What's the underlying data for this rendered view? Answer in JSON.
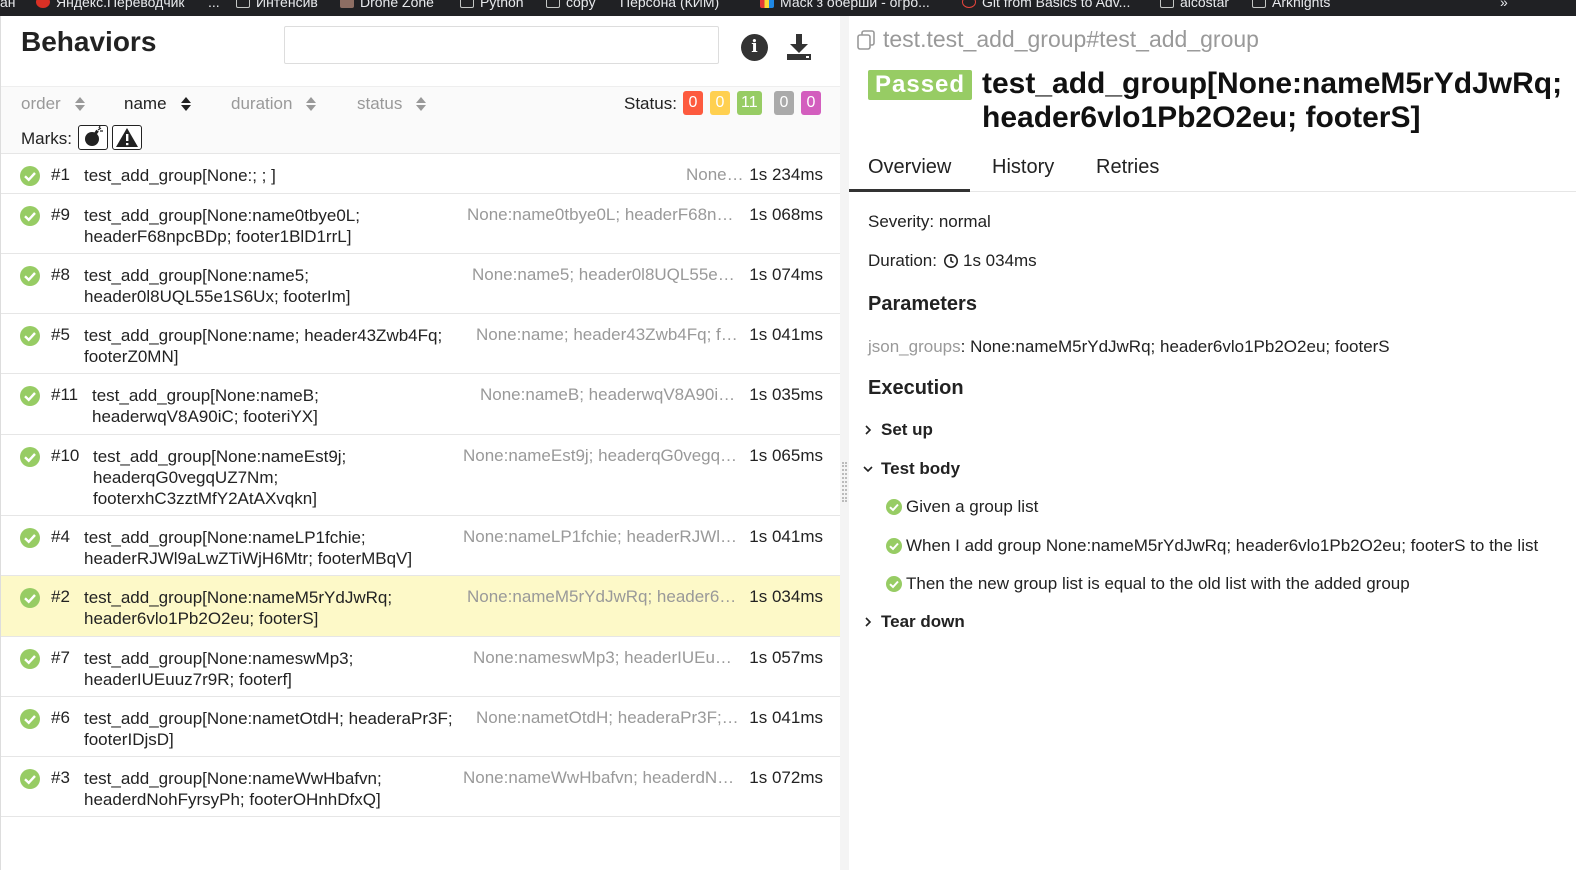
{
  "browser": {
    "bookmarks": [
      {
        "label": "ан",
        "icon": "none"
      },
      {
        "label": "Яндекс.Переводчик",
        "icon": "red"
      },
      {
        "label": "...",
        "icon": "none"
      },
      {
        "label": "Интенсив",
        "icon": "folder"
      },
      {
        "label": "Drone Zone",
        "icon": "dz"
      },
      {
        "label": "Python",
        "icon": "folder"
      },
      {
        "label": "copy",
        "icon": "folder"
      },
      {
        "label": "Персона (КИМ)",
        "icon": "none"
      },
      {
        "label": "Маск з оберши - огро...",
        "icon": "flag"
      },
      {
        "label": "Git from Basics to Adv...",
        "icon": "git"
      },
      {
        "label": "alcostar",
        "icon": "folder"
      },
      {
        "label": "Arknights",
        "icon": "folder"
      },
      {
        "label": "»",
        "icon": "none"
      }
    ]
  },
  "left": {
    "title": "Behaviors",
    "search": {
      "value": "",
      "placeholder": ""
    },
    "sort": {
      "order": "order",
      "name": "name",
      "duration": "duration",
      "status": "status"
    },
    "status_label": "Status:",
    "status_counts": [
      {
        "value": "0",
        "color": "#fd5a3e"
      },
      {
        "value": "0",
        "color": "#ffd050"
      },
      {
        "value": "11",
        "color": "#97cc64"
      },
      {
        "value": "0",
        "color": "#aaaaaa"
      },
      {
        "value": "0",
        "color": "#d35ebe"
      }
    ],
    "marks_label": "Marks:",
    "marks": [
      {
        "icon": "bomb-icon"
      },
      {
        "icon": "warning-icon"
      }
    ],
    "rows": [
      {
        "num": "#1",
        "name": "test_add_group[None:; ; ]",
        "params": "None:; ;",
        "duration": "1s 234ms",
        "selected": false
      },
      {
        "num": "#9",
        "name": "test_add_group[None:name0tbye0L; headerF68npcBDp; footer1BlD1rrL]",
        "params": "None:name0tbye0L; headerF68n…",
        "duration": "1s 068ms",
        "selected": false
      },
      {
        "num": "#8",
        "name": "test_add_group[None:name5; header0l8UQL55e1S6Ux; footerIm]",
        "params": "None:name5; header0l8UQL55e…",
        "duration": "1s 074ms",
        "selected": false
      },
      {
        "num": "#5",
        "name": "test_add_group[None:name; header43Zwb4Fq; footerZ0MN]",
        "params": "None:name; header43Zwb4Fq; f…",
        "duration": "1s 041ms",
        "selected": false
      },
      {
        "num": "#11",
        "name": "test_add_group[None:nameB; headerwqV8A90iC; footeriYX]",
        "params": "None:nameB; headerwqV8A90i…",
        "duration": "1s 035ms",
        "selected": false
      },
      {
        "num": "#10",
        "name": "test_add_group[None:nameEst9j; headerqG0vegqUZ7Nm; footerxhC3zztMfY2AtAXvqkn]",
        "params": "None:nameEst9j; headerqG0vegq…",
        "duration": "1s 065ms",
        "selected": false
      },
      {
        "num": "#4",
        "name": "test_add_group[None:nameLP1fchie; headerRJWl9aLwZTiWjH6Mtr; footerMBqV]",
        "params": "None:nameLP1fchie; headerRJWl…",
        "duration": "1s 041ms",
        "selected": false
      },
      {
        "num": "#2",
        "name": "test_add_group[None:nameM5rYdJwRq; header6vlo1Pb2O2eu; footerS]",
        "params": "None:nameM5rYdJwRq; header6…",
        "duration": "1s 034ms",
        "selected": true
      },
      {
        "num": "#7",
        "name": "test_add_group[None:nameswMp3; headerIUEuuz7r9R; footerf]",
        "params": "None:nameswMp3; headerIUEu…",
        "duration": "1s 057ms",
        "selected": false
      },
      {
        "num": "#6",
        "name": "test_add_group[None:nametOtdH; headeraPr3F; footerIDjsD]",
        "params": "None:nametOtdH; headeraPr3F;…",
        "duration": "1s 041ms",
        "selected": false
      },
      {
        "num": "#3",
        "name": "test_add_group[None:nameWwHbafvn; headerdNohFyrsyPh; footerOHnhDfxQ]",
        "params": "None:nameWwHbafvn; headerdN…",
        "duration": "1s 072ms",
        "selected": false
      }
    ]
  },
  "right": {
    "breadcrumb": "test.test_add_group#test_add_group",
    "status": "Passed",
    "title": "test_add_group[None:nameM5rYdJwRq; header6vlo1Pb2O2eu; footerS]",
    "tabs": [
      "Overview",
      "History",
      "Retries"
    ],
    "severity": "Severity: normal",
    "duration_label": "Duration:",
    "duration": "1s 034ms",
    "parameters_heading": "Parameters",
    "param_key": "json_groups",
    "param_value": ": None:nameM5rYdJwRq; header6vlo1Pb2O2eu; footerS",
    "execution_heading": "Execution",
    "setup": "Set up",
    "test_body": "Test body",
    "steps": [
      "Given a group list",
      "When I add group None:nameM5rYdJwRq; header6vlo1Pb2O2eu; footerS to the list",
      "Then the new group list is equal to the old list with the added group"
    ],
    "teardown": "Tear down"
  },
  "colors": {
    "passed": "#97cc64",
    "selected_row": "#fdf9c8"
  }
}
